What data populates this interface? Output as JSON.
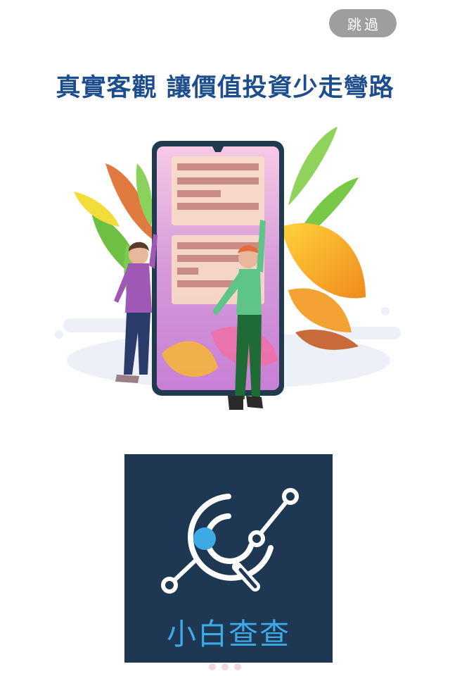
{
  "skip": {
    "label": "跳過"
  },
  "headline": "真實客觀 讓價值投資少走彎路",
  "logo": {
    "text": "小白查查",
    "icon": "magnifier-chart-icon"
  },
  "illustration": {
    "icon": "phone-people-leaves-illustration"
  },
  "pagination": {
    "count": 3,
    "current": 0
  },
  "colors": {
    "headline": "#1c4d8c",
    "skip_bg": "#9e9e9e",
    "logo_bg": "#1e3752",
    "logo_accent": "#3fa9e6"
  }
}
